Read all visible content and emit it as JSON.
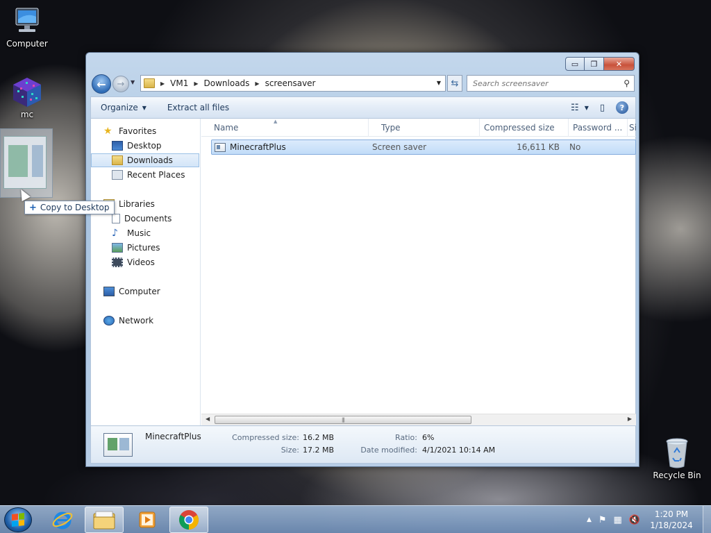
{
  "desktop": {
    "icons": [
      {
        "label": "Computer"
      },
      {
        "label": "mc"
      },
      {
        "label": "Recycle Bin"
      }
    ]
  },
  "drag": {
    "tooltip": "Copy to Desktop"
  },
  "window": {
    "controls": {
      "minimize": "▭",
      "maximize": "❐",
      "close": "✕"
    },
    "address": {
      "crumbs": [
        "VM1",
        "Downloads",
        "screensaver"
      ]
    },
    "search": {
      "placeholder": "Search screensaver"
    },
    "toolbar": {
      "organize": "Organize",
      "extract": "Extract all files"
    },
    "nav": {
      "favorites": "Favorites",
      "desktop": "Desktop",
      "downloads": "Downloads",
      "recent": "Recent Places",
      "libraries": "Libraries",
      "documents": "Documents",
      "music": "Music",
      "pictures": "Pictures",
      "videos": "Videos",
      "computer": "Computer",
      "network": "Network"
    },
    "columns": {
      "name": "Name",
      "type": "Type",
      "compressed": "Compressed size",
      "password": "Password ...",
      "size": "Si"
    },
    "files": [
      {
        "name": "MinecraftPlus",
        "type": "Screen saver",
        "compressed": "16,611 KB",
        "password": "No"
      }
    ],
    "details": {
      "name": "MinecraftPlus",
      "compressed_label": "Compressed size:",
      "compressed_value": "16.2 MB",
      "size_label": "Size:",
      "size_value": "17.2 MB",
      "ratio_label": "Ratio:",
      "ratio_value": "6%",
      "modified_label": "Date modified:",
      "modified_value": "4/1/2021 10:14 AM"
    }
  },
  "taskbar": {
    "clock_time": "1:20 PM",
    "clock_date": "1/18/2024"
  },
  "colors": {
    "selection": "#cce4fb",
    "accent": "#1e395b"
  }
}
